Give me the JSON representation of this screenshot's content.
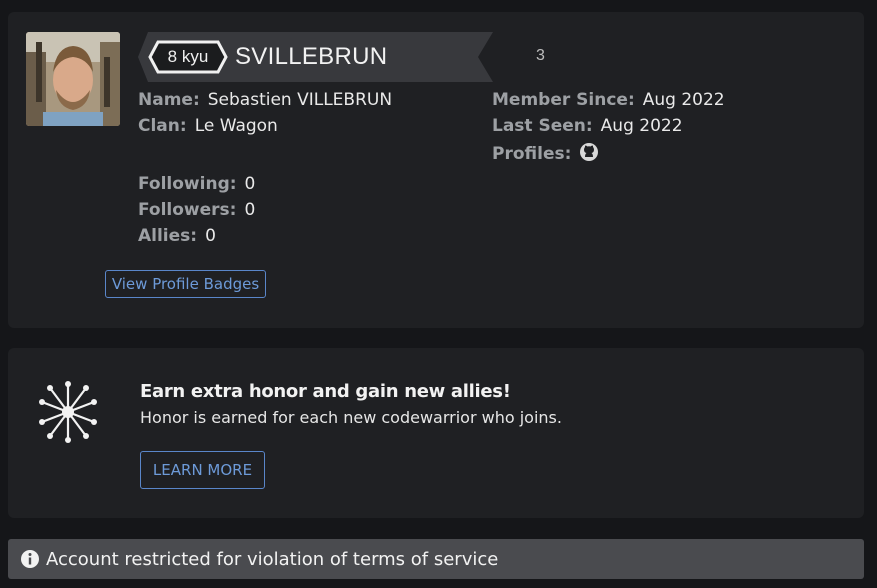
{
  "profile": {
    "rank": "8 kyu",
    "username": "SVILLEBRUN",
    "honor": "3",
    "fields_left": [
      {
        "label": "Name:",
        "value": "Sebastien VILLEBRUN"
      },
      {
        "label": "Clan:",
        "value": "Le Wagon"
      }
    ],
    "fields_right": [
      {
        "label": "Member Since:",
        "value": "Aug 2022"
      },
      {
        "label": "Last Seen:",
        "value": "Aug 2022"
      },
      {
        "label": "Profiles:",
        "icon": "github-icon"
      }
    ],
    "social": [
      {
        "label": "Following:",
        "value": "0"
      },
      {
        "label": "Followers:",
        "value": "0"
      },
      {
        "label": "Allies:",
        "value": "0"
      }
    ],
    "badges_button": "View Profile Badges"
  },
  "promo": {
    "title": "Earn extra honor and gain new allies!",
    "subtitle": "Honor is earned for each new codewarrior who joins.",
    "button": "LEARN MORE",
    "icon": "network-icon"
  },
  "alert": {
    "icon": "info-icon",
    "text": "Account restricted for violation of terms of service"
  },
  "colors": {
    "background": "#151619",
    "card": "#1f2023",
    "accent": "#6d9ad8",
    "alert_bg": "#4a4b4f"
  }
}
